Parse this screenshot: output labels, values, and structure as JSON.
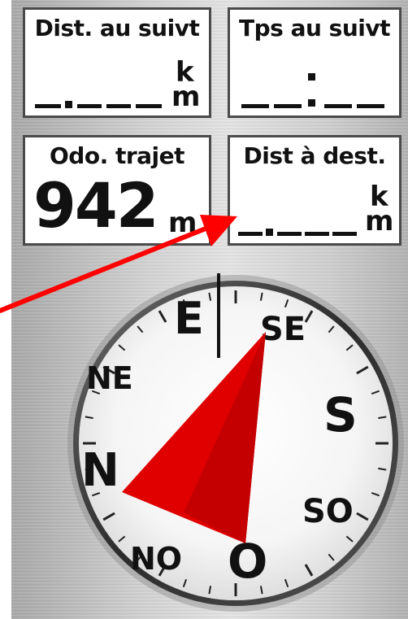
{
  "fields": {
    "dist_next": {
      "label": "Dist. au suivt",
      "unit_top": "k",
      "unit_bottom": "m"
    },
    "time_next": {
      "label": "Tps au suivt"
    },
    "trip_odo": {
      "label": "Odo. trajet",
      "value": "942",
      "unit": "m"
    },
    "dist_dest": {
      "label": "Dist à dest.",
      "unit_top": "k",
      "unit_bottom": "m"
    }
  },
  "compass": {
    "labels": {
      "E": "E",
      "SE": "SE",
      "S": "S",
      "SO": "SO",
      "O": "O",
      "NO": "NO",
      "N": "N",
      "NE": "NE"
    },
    "pointer_color": "#e00000",
    "pointer_shade_color": "#c40000"
  },
  "annotation": {
    "arrow_color": "#ff0000"
  }
}
